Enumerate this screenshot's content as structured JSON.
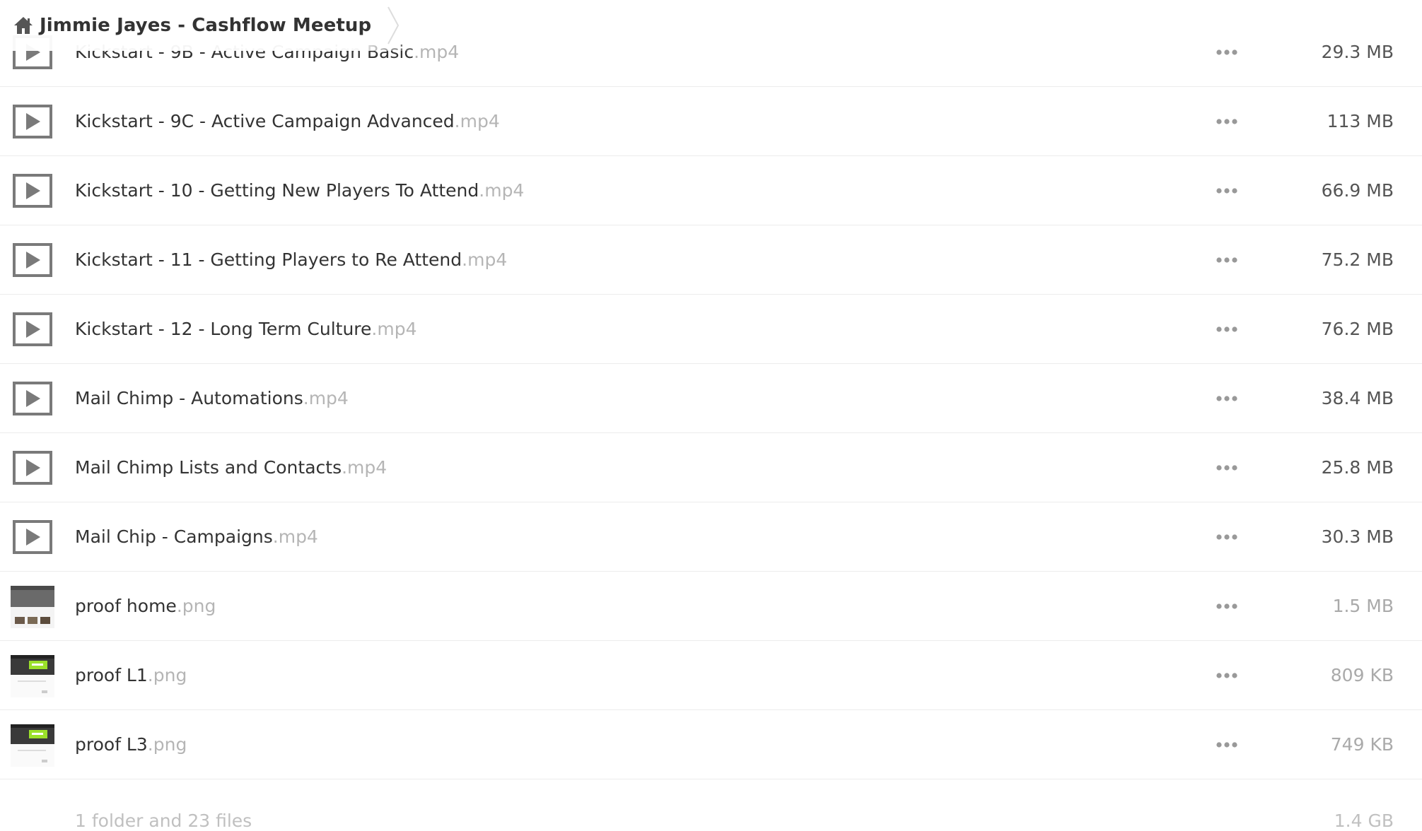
{
  "breadcrumb": {
    "home_icon": "home-icon",
    "title": "Jimmie Jayes - Cashflow Meetup"
  },
  "files": [
    {
      "name": "Kickstart - 9B - Active Campaign Basic",
      "ext": ".mp4",
      "size": "29.3 MB",
      "type": "video",
      "icon": "video-play-icon"
    },
    {
      "name": "Kickstart - 9C - Active Campaign Advanced",
      "ext": ".mp4",
      "size": "113 MB",
      "type": "video",
      "icon": "video-play-icon"
    },
    {
      "name": "Kickstart - 10 - Getting New Players To Attend",
      "ext": ".mp4",
      "size": "66.9 MB",
      "type": "video",
      "icon": "video-play-icon"
    },
    {
      "name": "Kickstart - 11 - Getting Players to Re Attend",
      "ext": ".mp4",
      "size": "75.2 MB",
      "type": "video",
      "icon": "video-play-icon"
    },
    {
      "name": "Kickstart - 12 - Long Term Culture",
      "ext": ".mp4",
      "size": "76.2 MB",
      "type": "video",
      "icon": "video-play-icon"
    },
    {
      "name": "Mail Chimp - Automations",
      "ext": ".mp4",
      "size": "38.4 MB",
      "type": "video",
      "icon": "video-play-icon"
    },
    {
      "name": "Mail Chimp Lists and Contacts",
      "ext": ".mp4",
      "size": "25.8 MB",
      "type": "video",
      "icon": "video-play-icon"
    },
    {
      "name": "Mail Chip - Campaigns",
      "ext": ".mp4",
      "size": "30.3 MB",
      "type": "video",
      "icon": "video-play-icon"
    },
    {
      "name": "proof home",
      "ext": ".png",
      "size": "1.5 MB",
      "type": "image",
      "icon": "image-thumbnail"
    },
    {
      "name": "proof L1",
      "ext": ".png",
      "size": "809 KB",
      "type": "image",
      "icon": "image-thumbnail"
    },
    {
      "name": "proof L3",
      "ext": ".png",
      "size": "749 KB",
      "type": "image",
      "icon": "image-thumbnail"
    }
  ],
  "row_actions": {
    "more_icon": "more-actions-icon"
  },
  "summary": {
    "count": "1 folder and 23 files",
    "total_size": "1.4 GB"
  }
}
